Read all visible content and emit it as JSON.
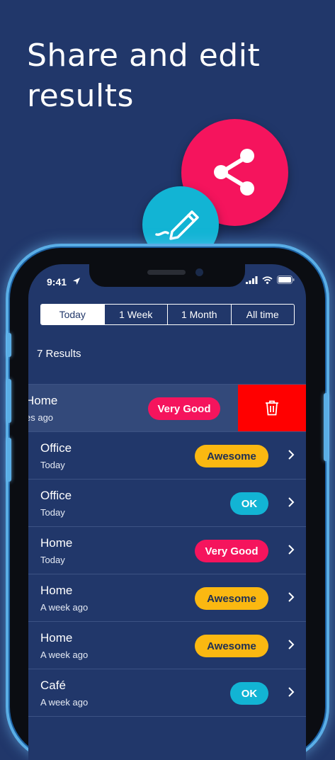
{
  "headline": {
    "line1": "Share and edit",
    "line2": "results"
  },
  "icons": {
    "share": "share-icon",
    "edit": "pencil-icon"
  },
  "colors": {
    "background": "#21376a",
    "share_circle": "#f5145d",
    "edit_circle": "#12b4d4",
    "awesome": "#fbb811",
    "ok": "#12b4d4",
    "very_good": "#f5145d",
    "delete": "#ff0000"
  },
  "status_bar": {
    "time": "9:41"
  },
  "segments": [
    {
      "label": "Today",
      "active": true
    },
    {
      "label": "1 Week",
      "active": false
    },
    {
      "label": "1 Month",
      "active": false
    },
    {
      "label": "All time",
      "active": false
    }
  ],
  "results_count": "7 Results",
  "rows": [
    {
      "title": "Home",
      "subtitle": "es ago",
      "rating": "Very Good",
      "swiped": true
    },
    {
      "title": "Office",
      "subtitle": "Today",
      "rating": "Awesome"
    },
    {
      "title": "Office",
      "subtitle": "Today",
      "rating": "OK"
    },
    {
      "title": "Home",
      "subtitle": "Today",
      "rating": "Very Good"
    },
    {
      "title": "Home",
      "subtitle": "A week ago",
      "rating": "Awesome"
    },
    {
      "title": "Home",
      "subtitle": "A week ago",
      "rating": "Awesome"
    },
    {
      "title": "Café",
      "subtitle": "A week ago",
      "rating": "OK"
    }
  ]
}
